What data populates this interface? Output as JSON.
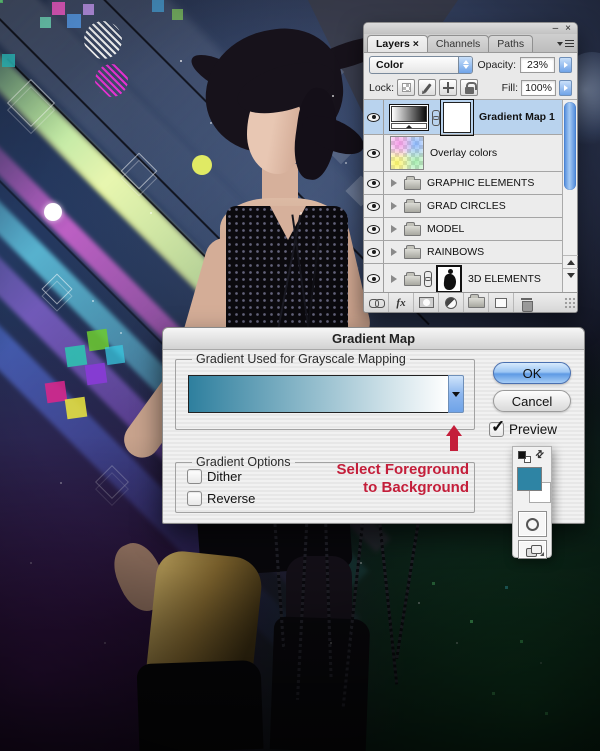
{
  "layers_panel": {
    "window_minimize": "–",
    "window_close": "×",
    "tabs": [
      {
        "label": "Layers ×"
      },
      {
        "label": "Channels"
      },
      {
        "label": "Paths"
      }
    ],
    "blend_mode_value": "Color",
    "opacity_label": "Opacity:",
    "opacity_value": "23%",
    "lock_label": "Lock:",
    "fill_label": "Fill:",
    "fill_value": "100%",
    "layers": [
      {
        "name": "Gradient Map 1",
        "type": "gradient-map-adjustment",
        "selected": true,
        "visible": true
      },
      {
        "name": "Overlay colors",
        "type": "pixel-layer",
        "selected": false,
        "visible": true
      },
      {
        "name": "GRAPHIC ELEMENTS",
        "type": "group",
        "selected": false,
        "visible": true
      },
      {
        "name": "GRAD CIRCLES",
        "type": "group",
        "selected": false,
        "visible": true
      },
      {
        "name": "MODEL",
        "type": "group",
        "selected": false,
        "visible": true
      },
      {
        "name": "RAINBOWS",
        "type": "group",
        "selected": false,
        "visible": true
      },
      {
        "name": "3D ELEMENTS",
        "type": "group-linked",
        "selected": false,
        "visible": true
      }
    ],
    "footer_fx_label": "fx"
  },
  "dialog": {
    "title": "Gradient Map",
    "gradient_group_label": "Gradient Used for Grayscale Mapping",
    "ok_label": "OK",
    "cancel_label": "Cancel",
    "preview_label": "Preview",
    "preview_checked": true,
    "check_glyph": "✓",
    "options_group_label": "Gradient Options",
    "dither_label": "Dither",
    "dither_checked": false,
    "reverse_label": "Reverse",
    "reverse_checked": false,
    "annotation_line1": "Select Foreground",
    "annotation_line2": "to Background",
    "annotation_color": "#c41e3a",
    "gradient_start_color": "#2e7f9e",
    "gradient_end_color": "#ffffff"
  },
  "toolbar_fragment": {
    "foreground_color": "#2e84a4",
    "background_color": "#ffffff"
  },
  "ui_colors": {
    "selected_layer_highlight": "#b9d3ee",
    "aqua_accent": "#6fa3e8"
  }
}
